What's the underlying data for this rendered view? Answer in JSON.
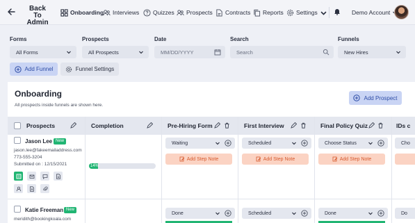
{
  "nav": {
    "back_label": "Back To Admin",
    "items": [
      {
        "label": "Onboarding",
        "icon": "grid-icon",
        "active": true
      },
      {
        "label": "Interviews",
        "icon": "users-icon"
      },
      {
        "label": "Quizzes",
        "icon": "help-circle-icon"
      },
      {
        "label": "Prospects",
        "icon": "users-icon"
      },
      {
        "label": "Contracts",
        "icon": "file-edit-icon"
      },
      {
        "label": "Reports",
        "icon": "copy-icon"
      },
      {
        "label": "Settings",
        "icon": "gear-icon"
      }
    ],
    "account_label": "Demo Account"
  },
  "filters": {
    "forms": {
      "label": "Forms",
      "value": "All Forms"
    },
    "prospects": {
      "label": "Prospects",
      "value": "All Prospects"
    },
    "date": {
      "label": "Date",
      "placeholder": "MM/DD/YYYY"
    },
    "search": {
      "label": "Search",
      "placeholder": "Search"
    },
    "funnels": {
      "label": "Funnels",
      "value": "New Hires"
    }
  },
  "buttons": {
    "add_funnel": "Add Funnel",
    "funnel_settings": "Funnel Settings",
    "add_prospect": "Add Prospect"
  },
  "onboarding": {
    "title": "Onboarding",
    "subtitle": "All prospects inside funnels are shown here."
  },
  "table": {
    "headers": [
      "Prospects",
      "Completion",
      "Pre-Hiring Form",
      "First Interview",
      "Final Policy Quiz",
      "IDs c"
    ],
    "rows": [
      {
        "name": "Jason Lee",
        "badge": "New",
        "email": "jason.lee@fakeemailaddress.com",
        "phone": "773-555-3204",
        "submitted": "Submitted on : 12/15/2021",
        "completion_pct": 14,
        "completion_label": "14%",
        "statuses": [
          "Waiting",
          "Scheduled",
          "Choose Status",
          "Cho"
        ],
        "step_note": "Add Step Note"
      },
      {
        "name": "Katie Freeman",
        "badge": "New",
        "email": "meridith@bookingkoala.com",
        "statuses": [
          "Done",
          "Scheduled",
          "Done",
          "Do"
        ]
      }
    ]
  },
  "colors": {
    "accent": "#2e4da6",
    "accent_bg": "#c9d4f4",
    "success": "#21b573",
    "note_bg": "#fbd3c3",
    "note_text": "#d65a2e"
  }
}
